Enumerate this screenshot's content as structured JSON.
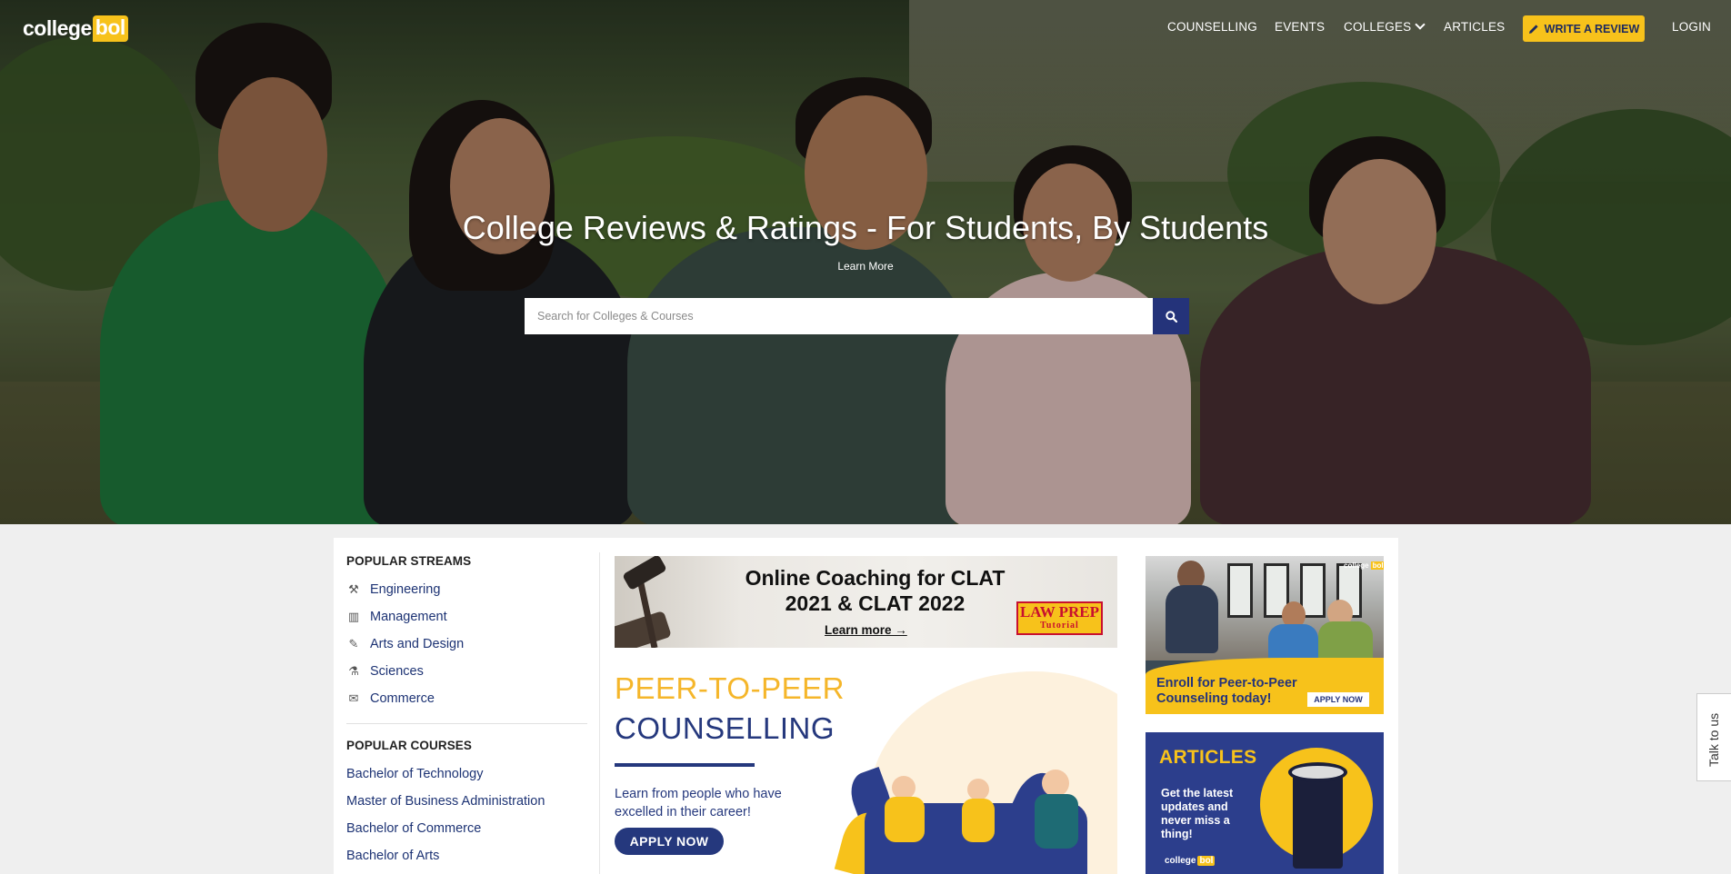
{
  "brand": {
    "logo_part1": "college",
    "logo_part2": "bol"
  },
  "nav": {
    "items": [
      "COUNSELLING",
      "EVENTS",
      "COLLEGES",
      "ARTICLES"
    ],
    "write_review": "WRITE A REVIEW",
    "login": "LOGIN"
  },
  "hero": {
    "title": "College Reviews & Ratings - For Students, By Students",
    "learn_more": "Learn More",
    "search_placeholder": "Search for Colleges & Courses"
  },
  "sidebar": {
    "streams_heading": "POPULAR STREAMS",
    "streams": [
      {
        "label": "Engineering",
        "icon": "engineering-icon"
      },
      {
        "label": "Management",
        "icon": "management-icon"
      },
      {
        "label": "Arts and Design",
        "icon": "arts-icon"
      },
      {
        "label": "Sciences",
        "icon": "sciences-icon"
      },
      {
        "label": "Commerce",
        "icon": "commerce-icon"
      }
    ],
    "courses_heading": "POPULAR COURSES",
    "courses": [
      "Bachelor of Technology",
      "Master of Business Administration",
      "Bachelor of Commerce",
      "Bachelor of Arts"
    ]
  },
  "banners": {
    "clat": {
      "line1": "Online Coaching for CLAT",
      "line2": "2021 & CLAT 2022",
      "learn_more": "Learn more →",
      "brand_line1": "LAW PREP",
      "brand_line2": "Tutorial"
    },
    "peer": {
      "line1": "PEER-TO-PEER",
      "line2": "COUNSELLING",
      "text": "Learn from people who have excelled in their career!",
      "apply": "APPLY NOW"
    },
    "enroll": {
      "text_line1": "Enroll for Peer-to-Peer",
      "text_line2": "Counseling today!",
      "apply": "APPLY NOW"
    },
    "articles": {
      "heading": "ARTICLES",
      "text": "Get the latest updates and never miss a thing!"
    }
  },
  "talk_to_us": "Talk to us",
  "colors": {
    "accent_yellow": "#f7c21b",
    "brand_navy": "#24337a",
    "link_blue": "#1d3374"
  }
}
